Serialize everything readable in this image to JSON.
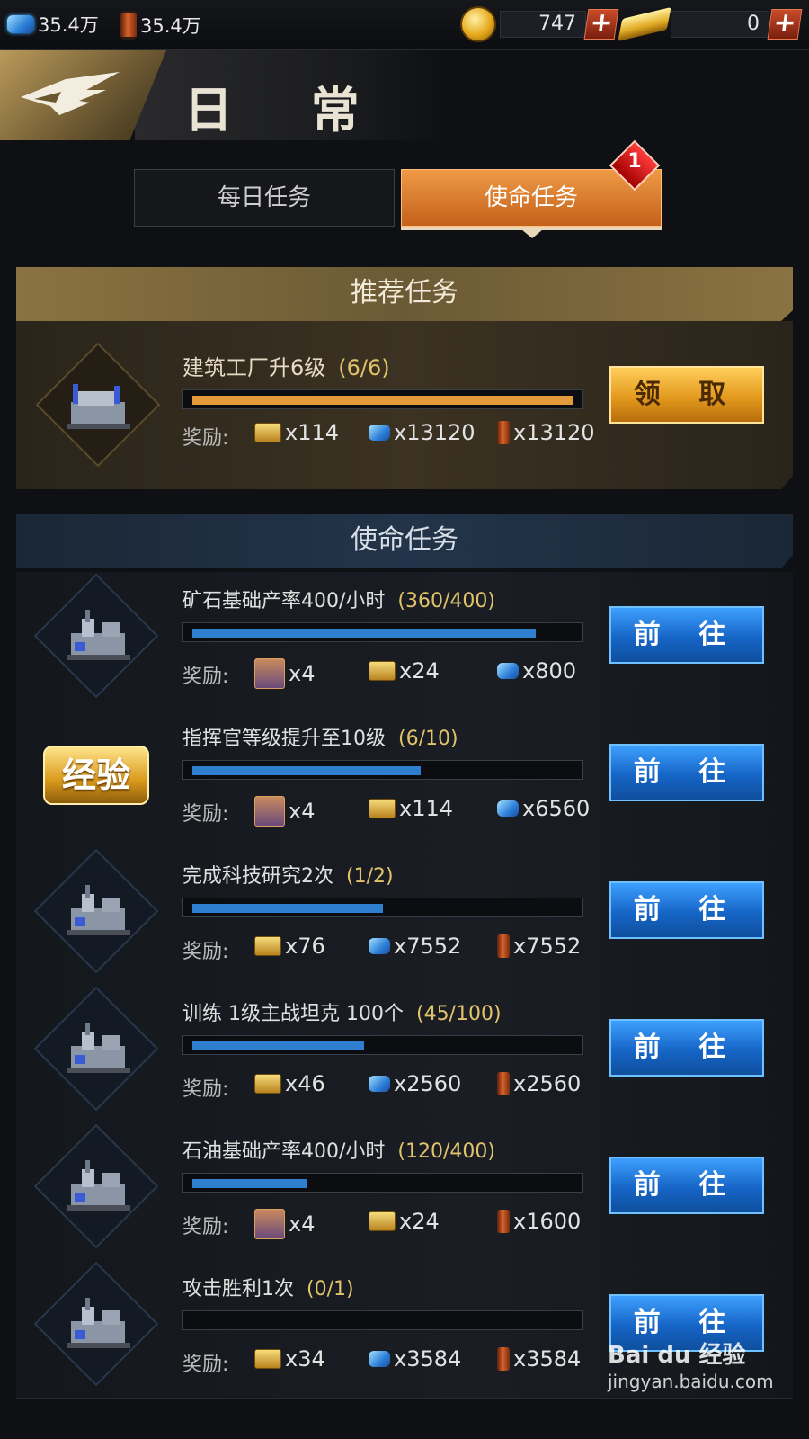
{
  "resources": {
    "crystal": "35.4万",
    "oil": "35.4万",
    "coins": "747",
    "gold": "0"
  },
  "header": {
    "title": "日 常"
  },
  "tabs": {
    "daily": "每日任务",
    "mission": "使命任务",
    "mission_badge": "1"
  },
  "recommended": {
    "section_title": "推荐任务",
    "task": {
      "title": "建筑工厂升6级",
      "progress_text": "(6/6)",
      "progress": 1.0,
      "reward_label": "奖励:",
      "rewards": [
        "x114",
        "x13120",
        "x13120"
      ],
      "button": "领 取"
    }
  },
  "missions": {
    "section_title": "使命任务",
    "reward_label": "奖励:",
    "button": "前 往",
    "items": [
      {
        "title": "矿石基础产率400/小时",
        "progress_text": "(360/400)",
        "progress": 0.9,
        "rewards": [
          "x4",
          "x24",
          "x800"
        ]
      },
      {
        "title": "指挥官等级提升至10级",
        "progress_text": "(6/10)",
        "progress": 0.6,
        "rewards": [
          "x4",
          "x114",
          "x6560"
        ]
      },
      {
        "title": "完成科技研究2次",
        "progress_text": "(1/2)",
        "progress": 0.5,
        "rewards": [
          "x76",
          "x7552",
          "x7552"
        ]
      },
      {
        "title": "训练 1级主战坦克 100个",
        "progress_text": "(45/100)",
        "progress": 0.45,
        "rewards": [
          "x46",
          "x2560",
          "x2560"
        ]
      },
      {
        "title": "石油基础产率400/小时",
        "progress_text": "(120/400)",
        "progress": 0.3,
        "rewards": [
          "x4",
          "x24",
          "x1600"
        ]
      },
      {
        "title": "攻击胜利1次",
        "progress_text": "(0/1)",
        "progress": 0.0,
        "rewards": [
          "x34",
          "x3584",
          "x3584"
        ]
      }
    ],
    "icon_badge_text": "经验"
  },
  "watermark": {
    "brand": "Bai du 经验",
    "url": "jingyan.baidu.com"
  }
}
